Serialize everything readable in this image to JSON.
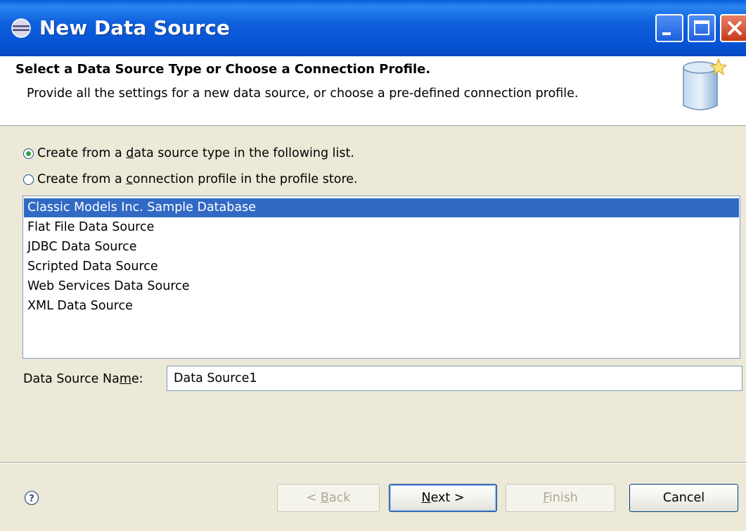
{
  "window": {
    "title": "New Data Source"
  },
  "header": {
    "title": "Select a Data Source Type or Choose a Connection Profile.",
    "description": "Provide all the settings for a new data source, or choose a pre-defined connection profile."
  },
  "options": {
    "from_type": {
      "pre": "Create from a ",
      "mnemonic": "d",
      "post": "ata source type in the following list.",
      "checked": true
    },
    "from_profile": {
      "pre": "Create from a ",
      "mnemonic": "c",
      "post": "onnection profile in the profile store.",
      "checked": false
    }
  },
  "data_source_types": {
    "items": [
      "Classic Models Inc. Sample Database",
      "Flat File Data Source",
      "JDBC Data Source",
      "Scripted Data Source",
      "Web Services Data Source",
      "XML Data Source"
    ],
    "selected": "Classic Models Inc. Sample Database"
  },
  "name_field": {
    "label_pre": "Data Source Na",
    "label_mnemonic": "m",
    "label_post": "e:",
    "value": "Data Source1"
  },
  "buttons": {
    "back": {
      "pre": "< ",
      "mnemonic": "B",
      "post": "ack",
      "enabled": false
    },
    "next": {
      "pre": "",
      "mnemonic": "N",
      "post": "ext >",
      "enabled": true
    },
    "finish": {
      "pre": "",
      "mnemonic": "F",
      "post": "inish",
      "enabled": false
    },
    "cancel": {
      "label": "Cancel",
      "enabled": true
    }
  },
  "icons": {
    "title": "eclipse-icon",
    "header": "database-icon",
    "help": "help-icon"
  },
  "colors": {
    "titlebar": "#0653D4",
    "selection": "#316AC5",
    "dialog_bg": "#ECE9D8"
  }
}
